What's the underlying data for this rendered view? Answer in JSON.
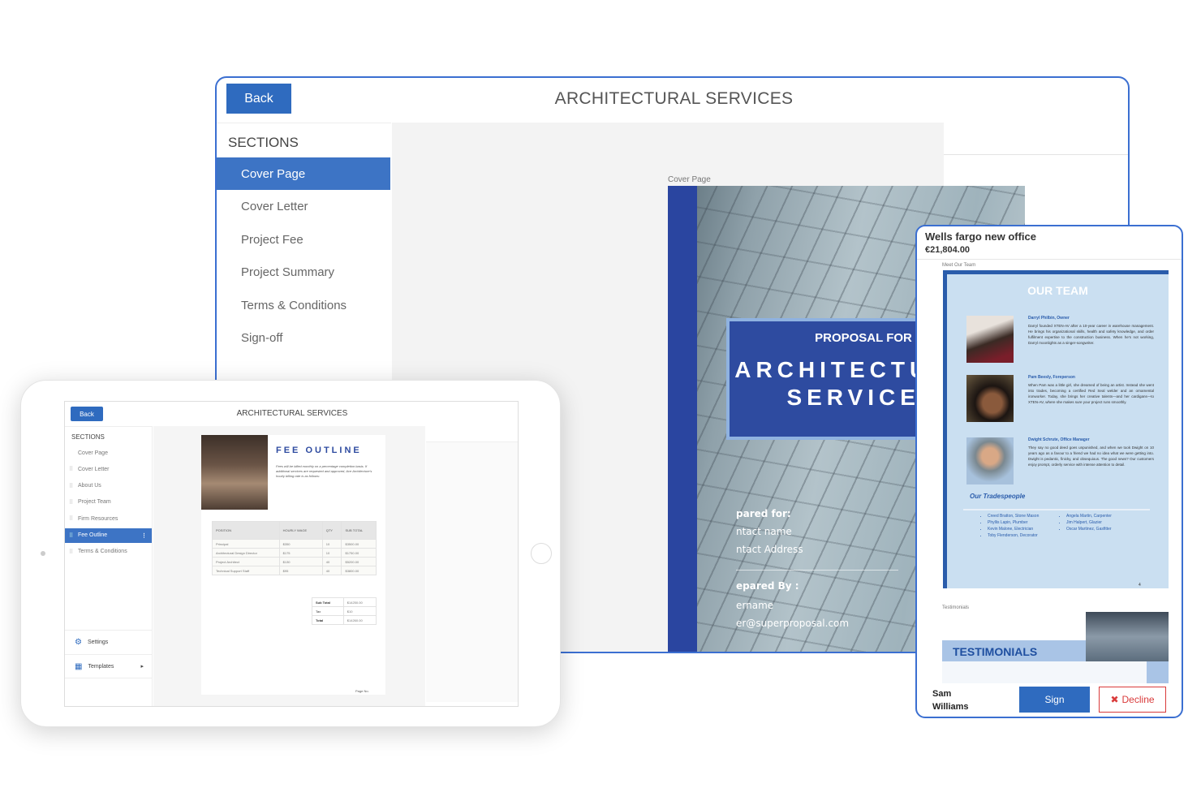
{
  "main": {
    "back_label": "Back",
    "title": "ARCHITECTURAL SERVICES",
    "sections_header": "SECTIONS",
    "sections": [
      {
        "label": "Cover Page",
        "active": true
      },
      {
        "label": "Cover Letter"
      },
      {
        "label": "Project Fee"
      },
      {
        "label": "Project Summary"
      },
      {
        "label": "Terms & Conditions"
      },
      {
        "label": "Sign-off"
      }
    ],
    "cover": {
      "label": "Cover Page",
      "proposal_for": "PROPOSAL FOR",
      "heading": "ARCHITECTURAL SERVICES",
      "prepared_for": "pared for:",
      "contact_name": "ntact name",
      "contact_address": "ntact Address",
      "prepared_by": "epared By :",
      "username": "ername",
      "email": "er@superproposal.com"
    }
  },
  "tablet": {
    "back_label": "Back",
    "title": "ARCHITECTURAL SERVICES",
    "sections_header": "SECTIONS",
    "sections": [
      {
        "label": "Cover Page"
      },
      {
        "label": "Cover Letter"
      },
      {
        "label": "About Us"
      },
      {
        "label": "Project Team"
      },
      {
        "label": "Firm Resources"
      },
      {
        "label": "Fee Outline",
        "active": true
      },
      {
        "label": "Terms & Conditions"
      }
    ],
    "settings_label": "Settings",
    "templates_label": "Templates",
    "fee": {
      "title": "FEE OUTLINE",
      "description": "Fees will be billed monthly on a percentage completion basis. If additional services are requested and approved, Ace Architecture's hourly billing rate is as follows:",
      "headers": [
        "POSITION",
        "HOURLY WAGE",
        "QTY",
        "SUB TOTAL"
      ],
      "rows": [
        [
          "Principal",
          "$350",
          "10",
          "$3500.00"
        ],
        [
          "Architectural Design Director",
          "$175",
          "10",
          "$1750.00"
        ],
        [
          "Project Architect",
          "$130",
          "40",
          "$5200.00"
        ],
        [
          "Technical Support Staff",
          "$95",
          "40",
          "$3800.00"
        ]
      ],
      "totals": [
        [
          "Sub Total",
          "$14250.00"
        ],
        [
          "Tax",
          "$10"
        ],
        [
          "Total",
          "$14260.00"
        ]
      ],
      "page_no": "Page No."
    }
  },
  "phone": {
    "title": "Wells fargo new office",
    "price": "€21,804.00",
    "team_label": "Meet Our Team",
    "team_heading": "OUR TEAM",
    "members": [
      {
        "name": "Darryl Philbin, Owner",
        "bio": "Darryl founded XTEN-AV after a 10-year career in warehouse management. He brings his organizational skills, health and safety knowledge, and order fulfilment expertise to the construction business. When he's not working, Darryl moonlights as a singer-songwriter."
      },
      {
        "name": "Pam Beesly, Foreperson",
        "bio": "When Pam was a little girl, she dreamed of being an artist. Instead she went into trades, becoming a certified Red Seal welder and an ornamental ironworker. Today, she brings her creative talents—and her cardigans—to XTEN-AV, where she makes sure your project runs smoothly."
      },
      {
        "name": "Dwight Schrute, Office Manager",
        "bio": "They say no good deed goes unpunished, and when we took Dwight on 10 years ago as a favour to a friend we had no idea what we were getting into. Dwight is pedantic, finicky, and obsequious. The good news? Our customers enjoy prompt, orderly service with intense attention to detail."
      }
    ],
    "tradespeople_heading": "Our Tradespeople",
    "tradespeople_left": [
      "Creed Bratton, Stone Mason",
      "Phyllis Lapin, Plumber",
      "Kevin Malone, Electrician",
      "Toby Flenderson, Decorator"
    ],
    "tradespeople_right": [
      "Angela Martin, Carpenter",
      "Jim Halpert, Glazier",
      "Oscar Martinez, Gasfitter"
    ],
    "page_number": "4",
    "testimonials_label": "Testimonials",
    "testimonials_heading": "TESTIMONIALS",
    "signer_first": "Sam",
    "signer_last": "Williams",
    "sign_label": "Sign",
    "decline_label": "Decline",
    "decline_icon": "✖"
  },
  "colors": {
    "brand_blue": "#2f6bbf",
    "navy": "#2e4ba0",
    "decline_red": "#d93a3a"
  }
}
